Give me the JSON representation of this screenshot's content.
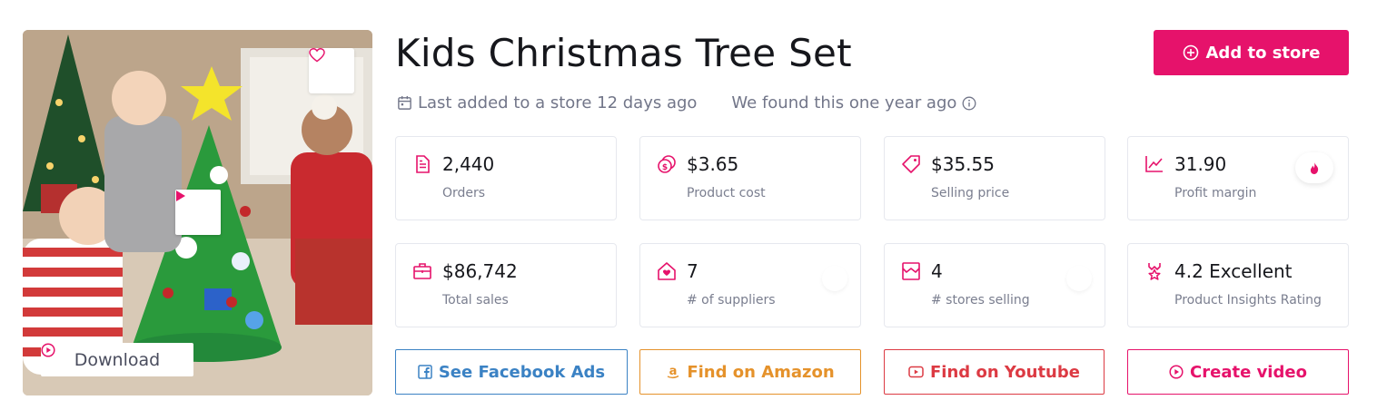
{
  "product": {
    "title": "Kids Christmas Tree Set",
    "download_label": "Download",
    "add_to_store_label": "Add to store",
    "last_added": "Last added to a store 12 days ago",
    "found": "We found this one year ago"
  },
  "stats": [
    {
      "value": "2,440",
      "label": "Orders",
      "icon": "orders-icon"
    },
    {
      "value": "$3.65",
      "label": "Product cost",
      "icon": "product-cost-icon"
    },
    {
      "value": "$35.55",
      "label": "Selling price",
      "icon": "price-tag-icon"
    },
    {
      "value": "31.90",
      "label": "Profit margin",
      "icon": "chart-line-icon"
    },
    {
      "value": "$86,742",
      "label": "Total sales",
      "icon": "briefcase-icon"
    },
    {
      "value": "7",
      "label": "# of suppliers",
      "icon": "supplier-house-icon"
    },
    {
      "value": "4",
      "label": "# stores selling",
      "icon": "store-icon"
    },
    {
      "value": "4.2 Excellent",
      "label": "Product Insights Rating",
      "icon": "award-icon"
    }
  ],
  "actions": [
    {
      "label": "See Facebook Ads",
      "icon": "facebook-icon",
      "color": "#3b82c4"
    },
    {
      "label": "Find on Amazon",
      "icon": "amazon-icon",
      "color": "#e5922b"
    },
    {
      "label": "Find on Youtube",
      "icon": "youtube-icon",
      "color": "#dc3a43"
    },
    {
      "label": "Create video",
      "icon": "play-circle-icon",
      "color": "#e6126b"
    }
  ],
  "colors": {
    "accent": "#e6126b",
    "text_muted": "#727689",
    "card_border": "#e6e8ee"
  }
}
